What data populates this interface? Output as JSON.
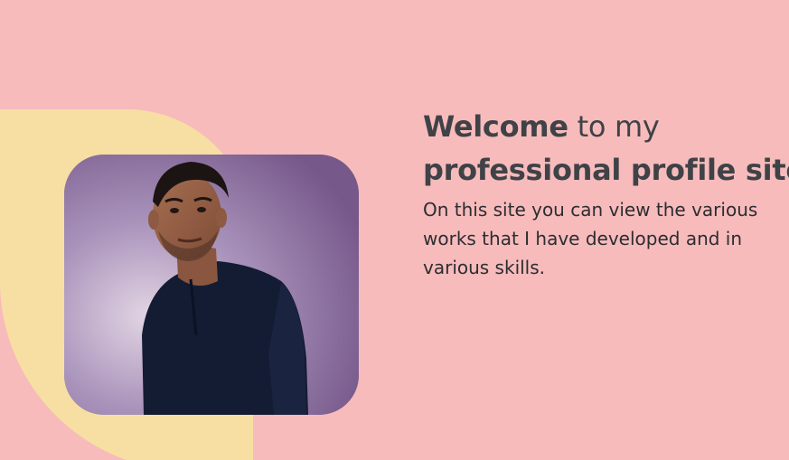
{
  "hero": {
    "headline": {
      "welcome": "Welcome",
      "connector": " to my",
      "emphasis": "professional profile site"
    },
    "intro": "On this site you can view the various works that I have developed and in various skills.",
    "photo": {
      "subject": "portrait photo of a man in a dark navy t-shirt"
    }
  },
  "colors": {
    "background": "#f7bbbb",
    "accent_blob": "#f7dfa3",
    "text": "#3f4247"
  }
}
